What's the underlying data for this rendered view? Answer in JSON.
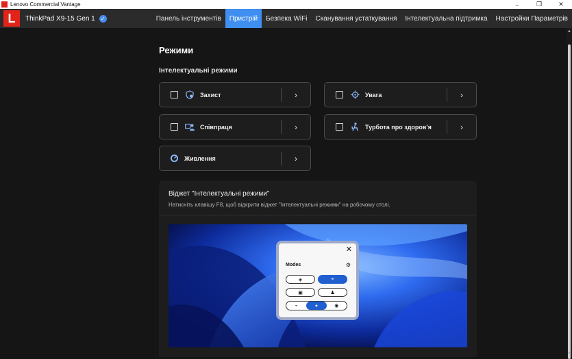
{
  "window": {
    "title": "Lenovo Commercial Vantage",
    "controls": [
      "–",
      "❐",
      "✕"
    ]
  },
  "header": {
    "logo_letter": "L",
    "device_name": "ThinkPad X9-15 Gen 1",
    "nav": [
      {
        "label": "Панель інструментів",
        "active": false
      },
      {
        "label": "Пристрій",
        "active": true
      },
      {
        "label": "Безпека WiFi",
        "active": false
      },
      {
        "label": "Сканування устаткування",
        "active": false
      },
      {
        "label": "Інтелектуальна підтримка",
        "active": false
      },
      {
        "label": "Настройки Параметрів",
        "active": false
      }
    ]
  },
  "page": {
    "title": "Режими",
    "section_title": "Інтелектуальні режими",
    "modes": [
      {
        "label": "Захист",
        "icon": "shield-icon",
        "has_checkbox": true
      },
      {
        "label": "Увага",
        "icon": "focus-target-icon",
        "has_checkbox": true
      },
      {
        "label": "Співпраця",
        "icon": "collaboration-icon",
        "has_checkbox": true
      },
      {
        "label": "Турбота про здоров'я",
        "icon": "posture-icon",
        "has_checkbox": true
      },
      {
        "label": "Живлення",
        "icon": "power-gauge-icon",
        "has_checkbox": false
      }
    ]
  },
  "widget": {
    "title": "Віджет \"Інтелектуальні режими\"",
    "description": "Натисніть клавішу F8, щоб відкрити віджет \"Інтелектуальні режими\" на робочому столі.",
    "popup": {
      "title": "Modes",
      "selected_mode_index": 1,
      "selected_power_index": 1
    }
  },
  "colors": {
    "accent": "#3f8ef0",
    "brand_red": "#e2231a",
    "background": "#151515"
  }
}
